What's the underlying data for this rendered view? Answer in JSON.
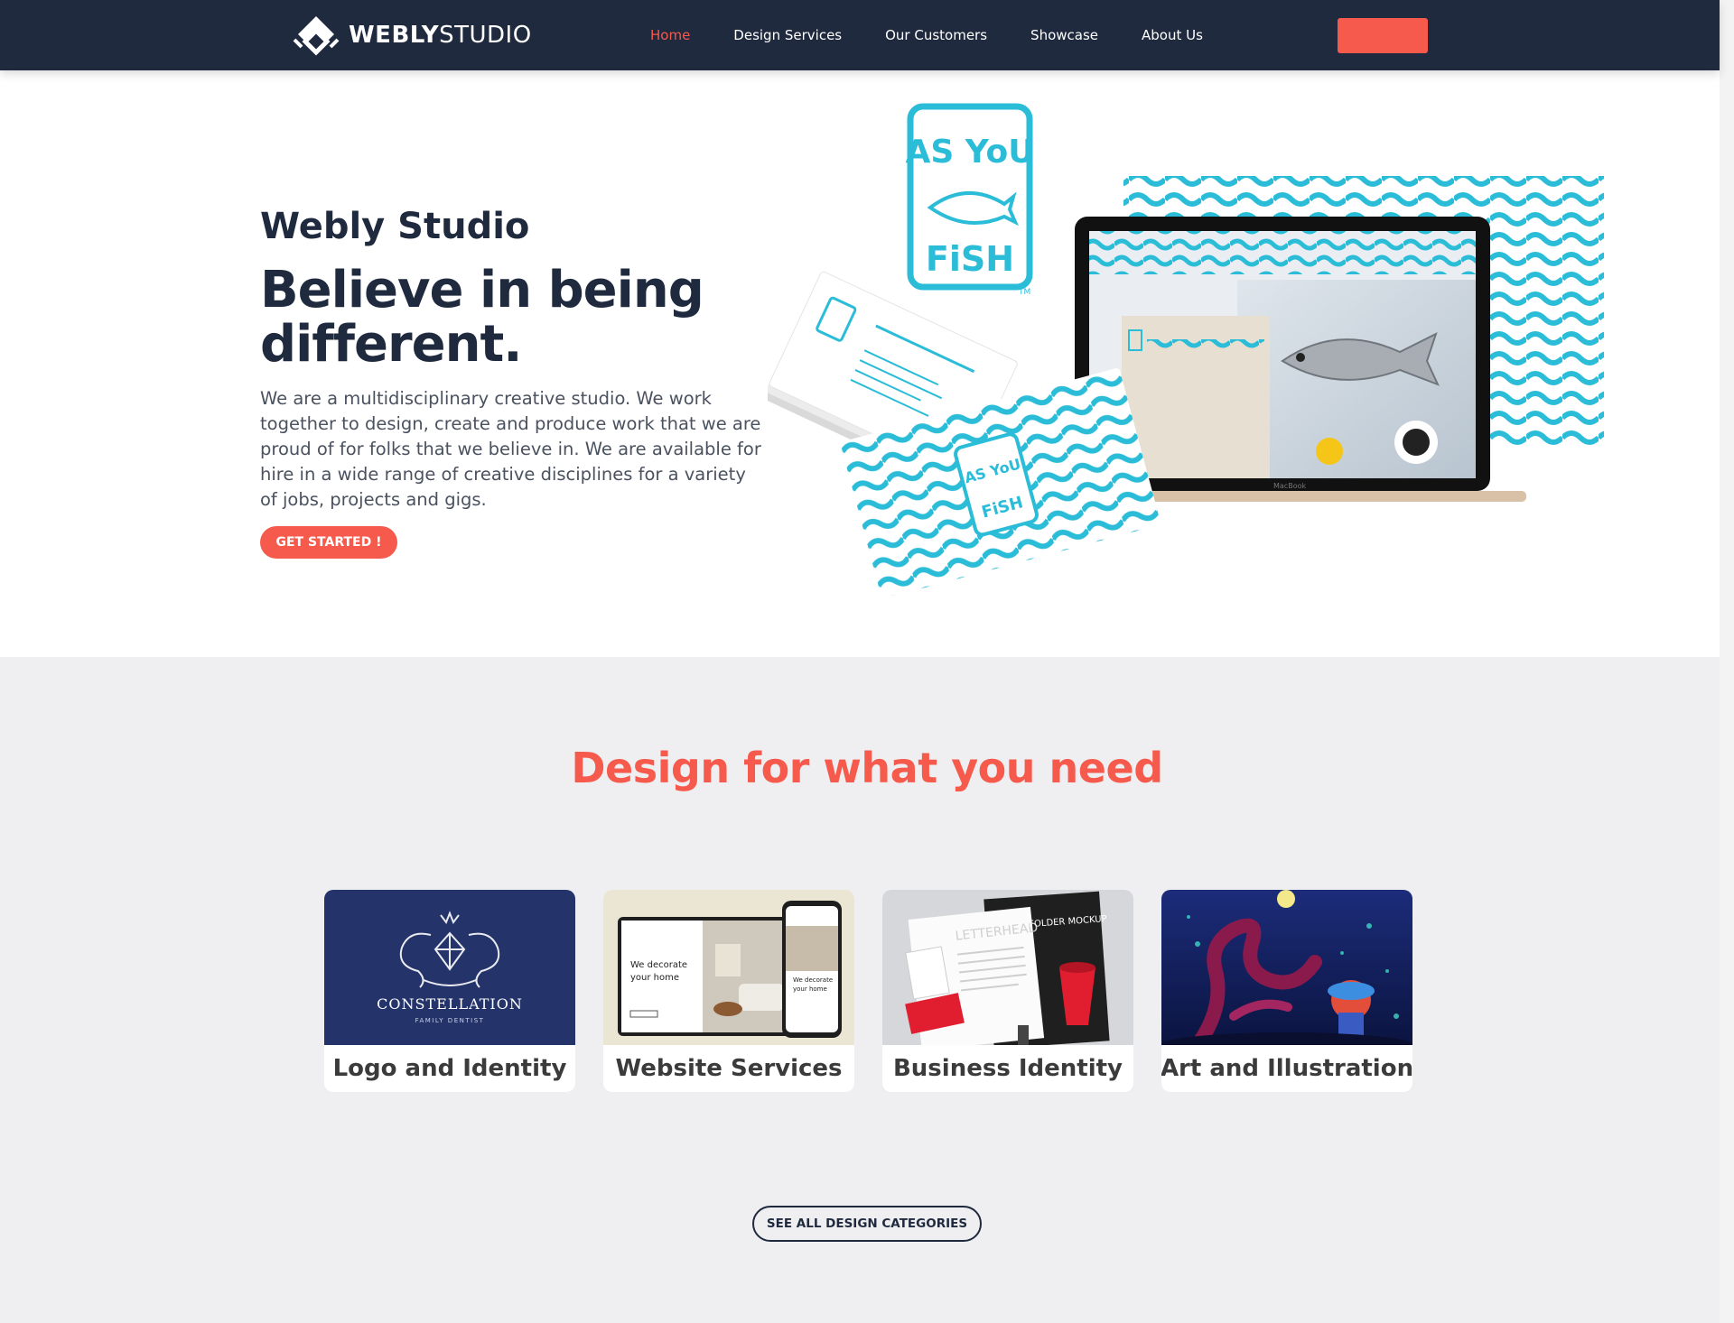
{
  "nav": {
    "logo_bold": "WEBLY",
    "logo_light": "STUDIO",
    "items": [
      {
        "label": "Home",
        "active": true
      },
      {
        "label": "Design Services"
      },
      {
        "label": "Our Customers"
      },
      {
        "label": "Showcase"
      },
      {
        "label": "About Us"
      }
    ],
    "cta_label": ""
  },
  "hero": {
    "brand": "Webly Studio",
    "title": "Believe in being different.",
    "description": "We are a multidisciplinary creative studio. We work together to design, create and produce work that we are proud of for folks that we believe in. We are available for hire in a wide range of creative disciplines for a variety of jobs, projects and gigs.",
    "button": "GET STARTED !",
    "art": {
      "badge_line1": "AS YoU",
      "badge_line2": "FiSH",
      "trademark": "TM",
      "laptop_brand": "MacBook"
    }
  },
  "services": {
    "title": "Design for what you need",
    "cards": [
      {
        "label": "Logo and Identity",
        "image_text": "CONSTELLATION",
        "image_subtext": "FAMILY DENTIST"
      },
      {
        "label": "Website Services",
        "image_text": "We decorate your home"
      },
      {
        "label": "Business Identity",
        "image_text": "LETTERHEAD",
        "image_subtext": "FOLDER MOCKUP"
      },
      {
        "label": "Art and Illustration"
      }
    ],
    "see_all": "SEE ALL DESIGN CATEGORIES"
  },
  "colors": {
    "navy": "#1f2a3f",
    "accent": "#f65a4c",
    "cyan": "#2bbcd8",
    "section_bg": "#efeff1"
  }
}
